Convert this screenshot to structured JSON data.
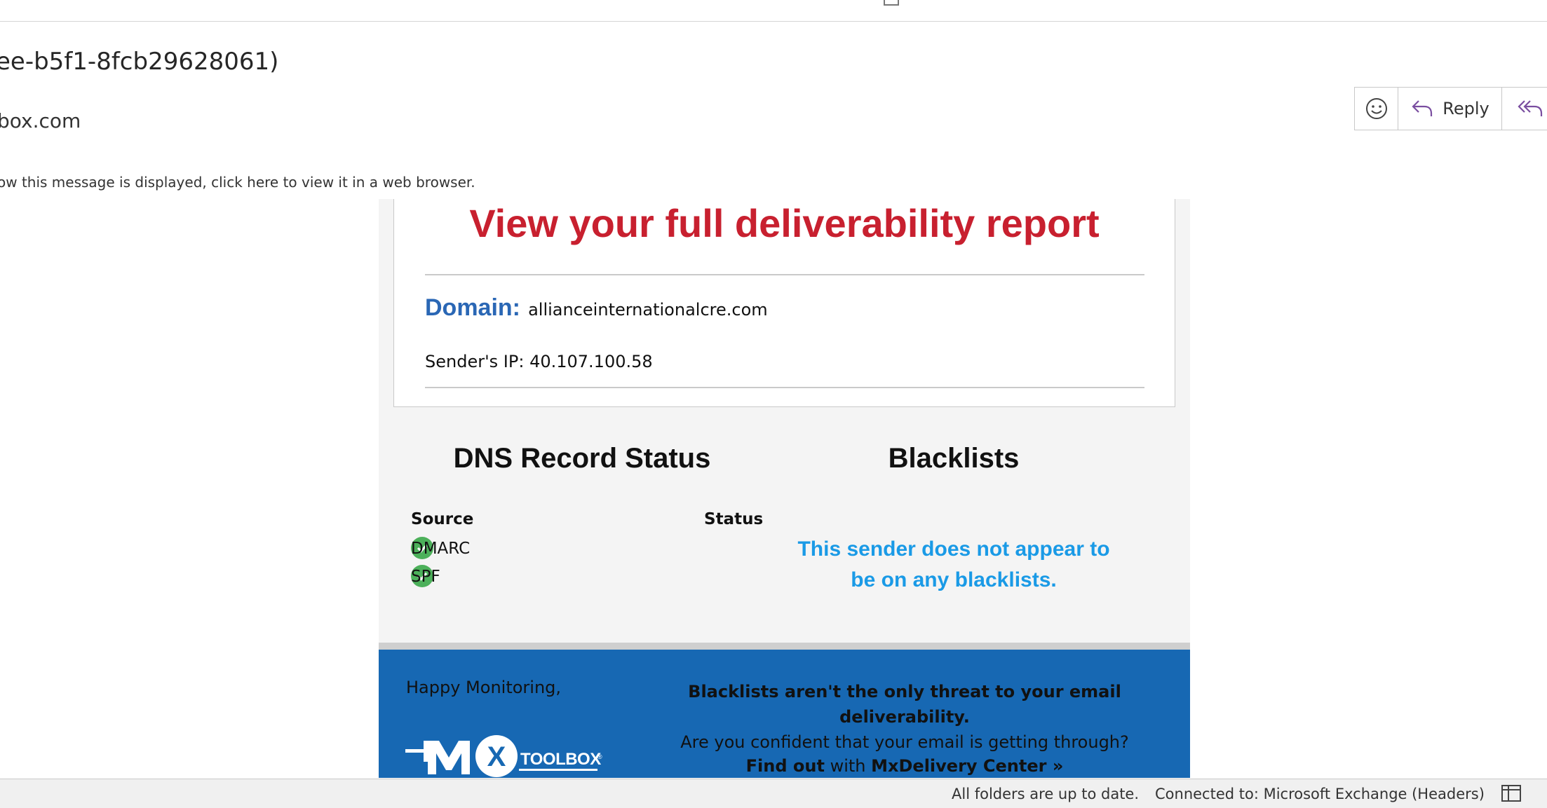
{
  "header": {
    "subject": "ee-b5f1-8fcb29628061)",
    "sender": "box.com",
    "display_notice": "ow this message is displayed, click here to view it in a web browser."
  },
  "actions": {
    "react_icon": "smiley-icon",
    "reply_label": "Reply",
    "reply_icon": "reply-arrow-icon",
    "reply_all_icon": "reply-all-arrow-icon"
  },
  "email": {
    "report_title": "View your full deliverability report",
    "domain_label": "Domain:",
    "domain_value": "allianceinternationalcre.com",
    "ip_line": "Sender's IP: 40.107.100.58",
    "dns_heading": "DNS Record Status",
    "blacklists_heading": "Blacklists",
    "dns_columns": [
      "Source",
      "Status"
    ],
    "dns_rows": [
      {
        "source": "DMARC",
        "status": "pass"
      },
      {
        "source": "SPF",
        "status": "pass"
      }
    ],
    "blacklist_note_line1": "This sender does not appear to",
    "blacklist_note_line2": "be on any blacklists.",
    "footer": {
      "greeting": "Happy Monitoring,",
      "logo_alt": "MX TOOLBOX",
      "threat_line1": "Blacklists aren't the only threat to your email deliverability.",
      "threat_line2": "Are you confident that your email is getting through?",
      "findout_prefix": "Find out",
      "findout_mid": " with ",
      "findout_link": "MxDelivery Center »"
    },
    "colors": {
      "title_red": "#c8202f",
      "domain_blue": "#2a67b5",
      "note_blue": "#1a9ae6",
      "footer_blue": "#1768b3",
      "check_green": "#4cb05a"
    }
  },
  "statusbar": {
    "sync": "All folders are up to date.",
    "connection": "Connected to: Microsoft Exchange (Headers)",
    "view_icon": "reading-pane-icon"
  }
}
